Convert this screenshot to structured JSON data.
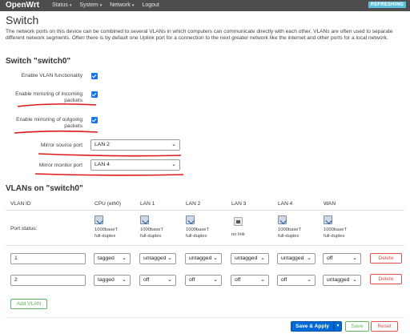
{
  "header": {
    "brand": "OpenWrt",
    "nav": [
      "Status",
      "System",
      "Network",
      "Logout"
    ],
    "refresh_badge": "REFRESHING"
  },
  "page": {
    "title": "Switch",
    "description": "The network ports on this device can be combined to several VLANs in which computers can communicate directly with each other. VLANs are often used to separate different network segments. Often there is by default one Uplink port for a connection to the next greater network like the internet and other ports for a local network."
  },
  "switch_section": {
    "title": "Switch \"switch0\"",
    "enable_vlan_label": "Enable VLAN functionality",
    "enable_vlan_checked": true,
    "mirror_incoming_label": "Enable mirroring of incoming packets",
    "mirror_incoming_checked": true,
    "mirror_outgoing_label": "Enable mirroring of outgoing packets",
    "mirror_outgoing_checked": true,
    "mirror_source_label": "Mirror source port",
    "mirror_source_value": "LAN 2",
    "mirror_monitor_label": "Mirror monitor port",
    "mirror_monitor_value": "LAN 4"
  },
  "vlans_section": {
    "title": "VLANs on \"switch0\"",
    "columns": [
      "VLAN ID",
      "CPU (eth0)",
      "LAN 1",
      "LAN 2",
      "LAN 3",
      "LAN 4",
      "WAN"
    ],
    "port_status_label": "Port status:",
    "port_status": [
      {
        "line1": "1000baseT",
        "line2": "full-duplex",
        "icon": "ethernet-port-up-icon"
      },
      {
        "line1": "1000baseT",
        "line2": "full-duplex",
        "icon": "ethernet-port-up-icon"
      },
      {
        "line1": "1000baseT",
        "line2": "full-duplex",
        "icon": "ethernet-port-up-icon"
      },
      {
        "line1": "no link",
        "line2": "",
        "icon": "ethernet-port-nolink-icon"
      },
      {
        "line1": "1000baseT",
        "line2": "full-duplex",
        "icon": "ethernet-port-up-icon"
      },
      {
        "line1": "1000baseT",
        "line2": "full-duplex",
        "icon": "ethernet-port-up-icon"
      }
    ],
    "rows": [
      {
        "vlan_id": "1",
        "ports": [
          "tagged",
          "untagged",
          "untagged",
          "untagged",
          "untagged",
          "off"
        ],
        "delete_label": "Delete"
      },
      {
        "vlan_id": "2",
        "ports": [
          "tagged",
          "off",
          "off",
          "off",
          "off",
          "untagged"
        ],
        "delete_label": "Delete"
      }
    ],
    "add_vlan_label": "Add VLAN"
  },
  "footer": {
    "save_apply_label": "Save & Apply",
    "save_label": "Save",
    "reset_label": "Reset"
  },
  "colors": {
    "topbar": "#4d4d4d",
    "accent_blue": "#0069d6",
    "annotation_red": "#e01818",
    "refresh_badge": "#5bc0de"
  }
}
